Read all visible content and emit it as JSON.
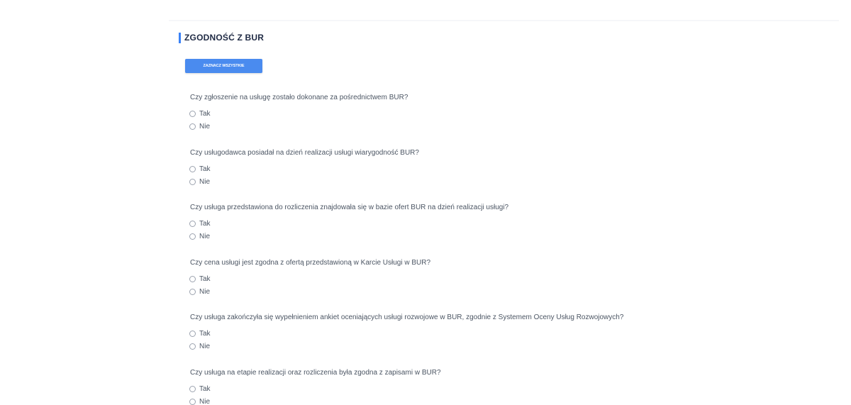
{
  "section": {
    "title": "ZGODNOŚĆ Z BUR",
    "select_all_label": "ZAZNACZ WSZYSTKIE"
  },
  "colors": {
    "accent": "#4a8bef",
    "title_bar": "#3b82f6",
    "text": "#4b5563"
  },
  "questions": [
    {
      "text": "Czy zgłoszenie na usługę zostało dokonane za pośrednictwem BUR?",
      "options": [
        "Tak",
        "Nie"
      ]
    },
    {
      "text": "Czy usługodawca posiadał na dzień realizacji usługi wiarygodność BUR?",
      "options": [
        "Tak",
        "Nie"
      ]
    },
    {
      "text": "Czy usługa przedstawiona do rozliczenia znajdowała się w bazie ofert BUR na dzień realizacji usługi?",
      "options": [
        "Tak",
        "Nie"
      ]
    },
    {
      "text": "Czy cena usługi jest zgodna z ofertą przedstawioną w Karcie Usługi w BUR?",
      "options": [
        "Tak",
        "Nie"
      ]
    },
    {
      "text": "Czy usługa zakończyła się wypełnieniem ankiet oceniających usługi rozwojowe w BUR, zgodnie z Systemem Oceny Usług Rozwojowych?",
      "options": [
        "Tak",
        "Nie"
      ]
    },
    {
      "text": "Czy usługa na etapie realizacji oraz rozliczenia była zgodna z zapisami w BUR?",
      "options": [
        "Tak",
        "Nie"
      ]
    }
  ]
}
